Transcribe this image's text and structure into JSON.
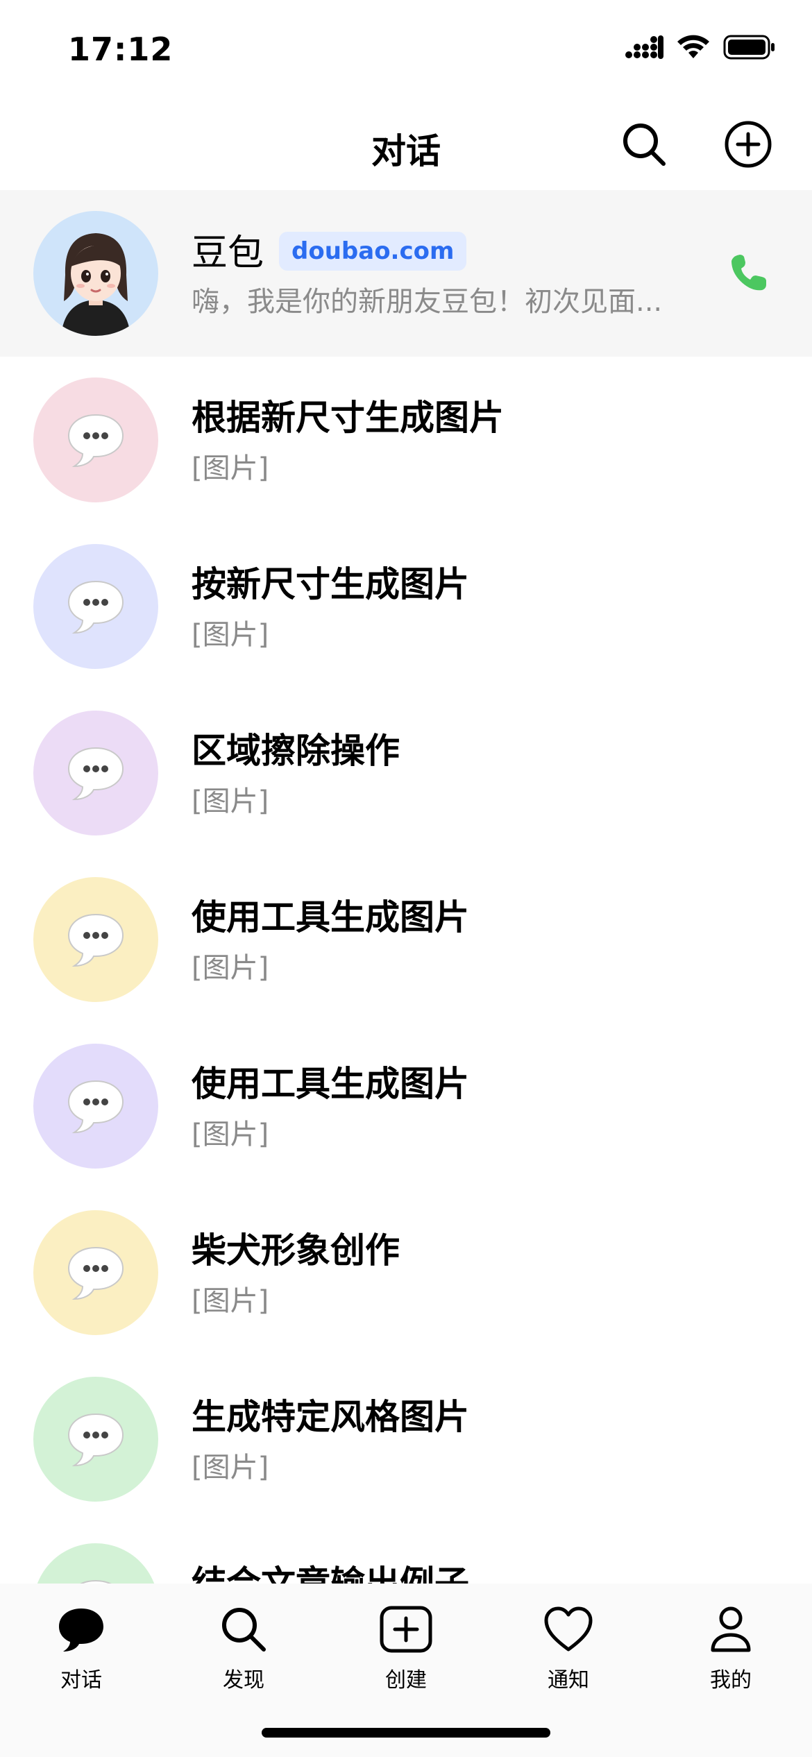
{
  "status_bar": {
    "time": "17:12"
  },
  "header": {
    "title": "对话"
  },
  "featured": {
    "name": "豆包",
    "badge": "doubao.com",
    "preview": "嗨，我是你的新朋友豆包！初次见面..."
  },
  "conversations": [
    {
      "title": "根据新尺寸生成图片",
      "preview": "[图片]",
      "color": "#f7dce3"
    },
    {
      "title": "按新尺寸生成图片",
      "preview": "[图片]",
      "color": "#dfe3fd"
    },
    {
      "title": "区域擦除操作",
      "preview": "[图片]",
      "color": "#ecdcf6"
    },
    {
      "title": "使用工具生成图片",
      "preview": "[图片]",
      "color": "#fbefc2"
    },
    {
      "title": "使用工具生成图片",
      "preview": "[图片]",
      "color": "#e3dcfb"
    },
    {
      "title": "柴犬形象创作",
      "preview": "[图片]",
      "color": "#fbefc2"
    },
    {
      "title": "生成特定风格图片",
      "preview": "[图片]",
      "color": "#d3f2d6"
    },
    {
      "title": "结合文章输出例子",
      "preview": "",
      "color": "#d3f2d6"
    }
  ],
  "tabs": [
    {
      "label": "对话",
      "icon": "chat-bubble-icon"
    },
    {
      "label": "发现",
      "icon": "search-icon"
    },
    {
      "label": "创建",
      "icon": "add-square-icon"
    },
    {
      "label": "通知",
      "icon": "heart-icon"
    },
    {
      "label": "我的",
      "icon": "person-icon"
    }
  ],
  "colors": {
    "badge_text": "#2b6cf0",
    "phone": "#4cc760"
  }
}
